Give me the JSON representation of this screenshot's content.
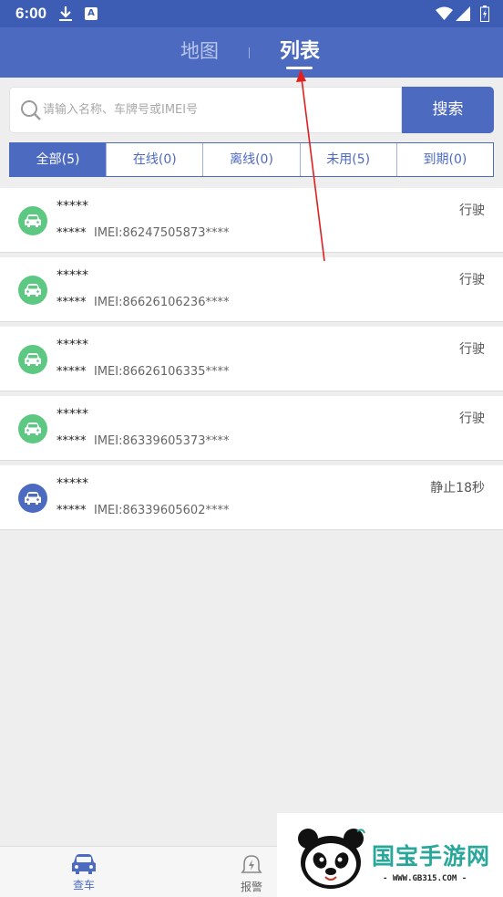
{
  "status_bar": {
    "time": "6:00",
    "app_icon_letter": "A"
  },
  "header": {
    "tab_map": "地图",
    "tab_list": "列表"
  },
  "search": {
    "placeholder": "请输入名称、车牌号或IMEI号",
    "button": "搜索"
  },
  "filters": [
    "全部(5)",
    "在线(0)",
    "离线(0)",
    "未用(5)",
    "到期(0)"
  ],
  "vehicles": [
    {
      "name": "*****",
      "plate": "*****",
      "imei": "IMEI:86247505873****",
      "status": "行驶",
      "color": "#5cc882"
    },
    {
      "name": "*****",
      "plate": "*****",
      "imei": "IMEI:86626106236****",
      "status": "行驶",
      "color": "#5cc882"
    },
    {
      "name": "*****",
      "plate": "*****",
      "imei": "IMEI:86626106335****",
      "status": "行驶",
      "color": "#5cc882"
    },
    {
      "name": "*****",
      "plate": "*****",
      "imei": "IMEI:86339605373****",
      "status": "行驶",
      "color": "#5cc882"
    },
    {
      "name": "*****",
      "plate": "*****",
      "imei": "IMEI:86339605602****",
      "status": "静止18秒",
      "color": "#4d6ac1"
    }
  ],
  "bottom_nav": {
    "cars": "查车",
    "alarm": "报警"
  },
  "watermark": {
    "title": "国宝手游网",
    "url": "- WWW.GB315.COM -"
  },
  "colors": {
    "primary": "#4d6ac1",
    "status_bar": "#3d5db4",
    "moving": "#5cc882",
    "annotation_arrow": "#e02020"
  },
  "icons": [
    "download-icon",
    "app-icon",
    "wifi-icon",
    "signal-icon",
    "battery-icon",
    "search-icon",
    "car-icon",
    "alarm-bell-icon"
  ]
}
